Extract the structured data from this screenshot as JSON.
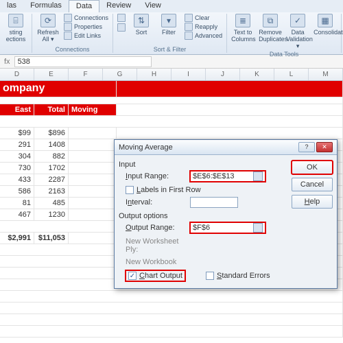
{
  "ribbon": {
    "tabs": [
      "las",
      "Formulas",
      "Data",
      "Review",
      "View"
    ],
    "active_tab": "Data",
    "sting_label": "sting",
    "ections_label": "ections",
    "refresh_all": "Refresh All ▾",
    "connections": "Connections",
    "properties": "Properties",
    "edit_links": "Edit Links",
    "group_connections": "Connections",
    "sort_az": "A↓Z",
    "sort_za": "Z↓A",
    "sort": "Sort",
    "filter": "Filter",
    "clear": "Clear",
    "reapply": "Reapply",
    "advanced": "Advanced",
    "group_sortfilter": "Sort & Filter",
    "text_to_columns": "Text to Columns",
    "remove_duplicates": "Remove Duplicates",
    "data_validation": "Data Validation ▾",
    "consolidate": "Consolidate",
    "group_datatools": "Data Tools"
  },
  "formula_bar": {
    "value": "538"
  },
  "columns": [
    "D",
    "E",
    "F",
    "G",
    "H",
    "I",
    "J",
    "K",
    "L",
    "M"
  ],
  "sheet": {
    "title": "ompany",
    "hdr_east": "East",
    "hdr_total": "Total",
    "hdr_moving": "Moving Avg.",
    "rows": [
      {
        "east": "$99",
        "total": "$896"
      },
      {
        "east": "291",
        "total": "1408"
      },
      {
        "east": "304",
        "total": "882"
      },
      {
        "east": "730",
        "total": "1702"
      },
      {
        "east": "433",
        "total": "2287"
      },
      {
        "east": "586",
        "total": "2163"
      },
      {
        "east": "81",
        "total": "485"
      },
      {
        "east": "467",
        "total": "1230"
      }
    ],
    "sum_east": "$2,991",
    "sum_total": "$11,053"
  },
  "dialog": {
    "title": "Moving Average",
    "help_icon": "?",
    "min_icon": "–",
    "close_icon": "✕",
    "section_input": "Input",
    "input_range_label": "Input Range:",
    "input_range_value": "$E$6:$E$13",
    "labels_first_row": "Labels in First Row",
    "interval_label": "Interval:",
    "interval_value": "",
    "section_output": "Output options",
    "output_range_label": "Output Range:",
    "output_range_value": "$F$6",
    "new_ws_ply": "New Worksheet Ply:",
    "new_wb": "New Workbook",
    "chart_output": "Chart Output",
    "chart_output_checked": true,
    "standard_errors": "Standard Errors",
    "ok": "OK",
    "cancel": "Cancel",
    "help": "Help"
  }
}
